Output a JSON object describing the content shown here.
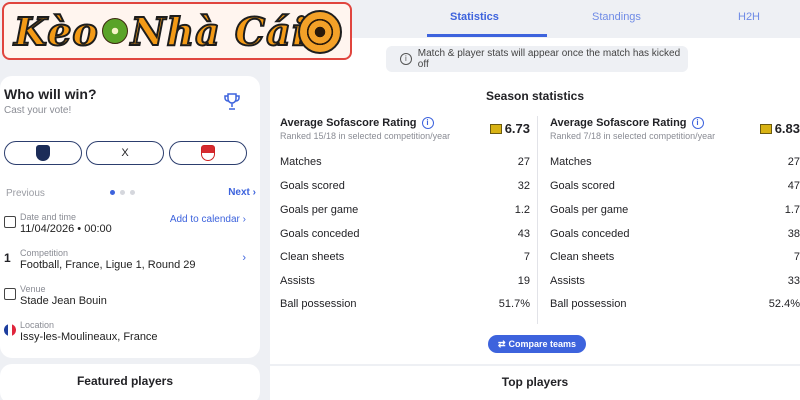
{
  "logo": {
    "text": "Kèo Nhà Cái",
    "part1": "Kèo",
    "part2": "Nhà Cái"
  },
  "tabs": [
    {
      "label": "Statistics"
    },
    {
      "label": "Standings"
    },
    {
      "label": "H2H"
    }
  ],
  "notice": "Match & player stats will appear once the match has kicked off",
  "vote": {
    "title": "Who will win?",
    "subtitle": "Cast your vote!",
    "draw_label": "X",
    "previous": "Previous",
    "next": "Next"
  },
  "match_info": {
    "date_label": "Date and time",
    "date_value": "11/04/2026",
    "time_value": "00:00",
    "add_calendar": "Add to calendar",
    "competition_label": "Competition",
    "competition_value": "Football, France, Ligue 1, Round 29",
    "venue_label": "Venue",
    "venue_value": "Stade Jean Bouin",
    "location_label": "Location",
    "location_value": "Issy-les-Moulineaux, France"
  },
  "featured_players": {
    "title": "Featured players"
  },
  "season": {
    "title": "Season statistics",
    "teams": [
      {
        "rating_label": "Average Sofascore Rating",
        "ranked": "Ranked 15/18 in selected competition/year",
        "rating": "6.73",
        "stats": [
          {
            "label": "Matches",
            "value": "27"
          },
          {
            "label": "Goals scored",
            "value": "32"
          },
          {
            "label": "Goals per game",
            "value": "1.2"
          },
          {
            "label": "Goals conceded",
            "value": "43"
          },
          {
            "label": "Clean sheets",
            "value": "7"
          },
          {
            "label": "Assists",
            "value": "19"
          },
          {
            "label": "Ball possession",
            "value": "51.7%"
          }
        ]
      },
      {
        "rating_label": "Average Sofascore Rating",
        "ranked": "Ranked 7/18 in selected competition/year",
        "rating": "6.83",
        "stats": [
          {
            "label": "Matches",
            "value": "27"
          },
          {
            "label": "Goals scored",
            "value": "47"
          },
          {
            "label": "Goals per game",
            "value": "1.7"
          },
          {
            "label": "Goals conceded",
            "value": "38"
          },
          {
            "label": "Clean sheets",
            "value": "7"
          },
          {
            "label": "Assists",
            "value": "33"
          },
          {
            "label": "Ball possession",
            "value": "52.4%"
          }
        ]
      }
    ],
    "compare_label": "Compare teams"
  },
  "top_players": {
    "title": "Top players"
  },
  "colors": {
    "accent": "#3d63dd",
    "rating": "#d8b213",
    "logo_orange": "#f39a16",
    "logo_border": "#e0453e"
  }
}
